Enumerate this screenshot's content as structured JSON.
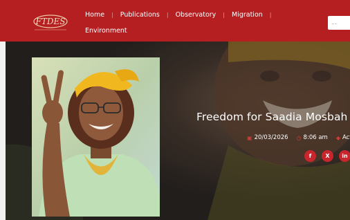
{
  "header": {
    "logo_text": "FTDES",
    "nav": [
      "Home",
      "Publications",
      "Observatory",
      "Migration"
    ],
    "nav_row2": "Environment",
    "search_placeholder": "..."
  },
  "article": {
    "title": "Freedom for Saadia Mosbah",
    "date": "20/03/2026",
    "time": "8:06 am",
    "category": "Actu"
  },
  "share": {
    "facebook": "f",
    "x": "X",
    "linkedin": "in"
  },
  "colors": {
    "brand_red": "#b51f22",
    "share_red": "#c8262c"
  }
}
